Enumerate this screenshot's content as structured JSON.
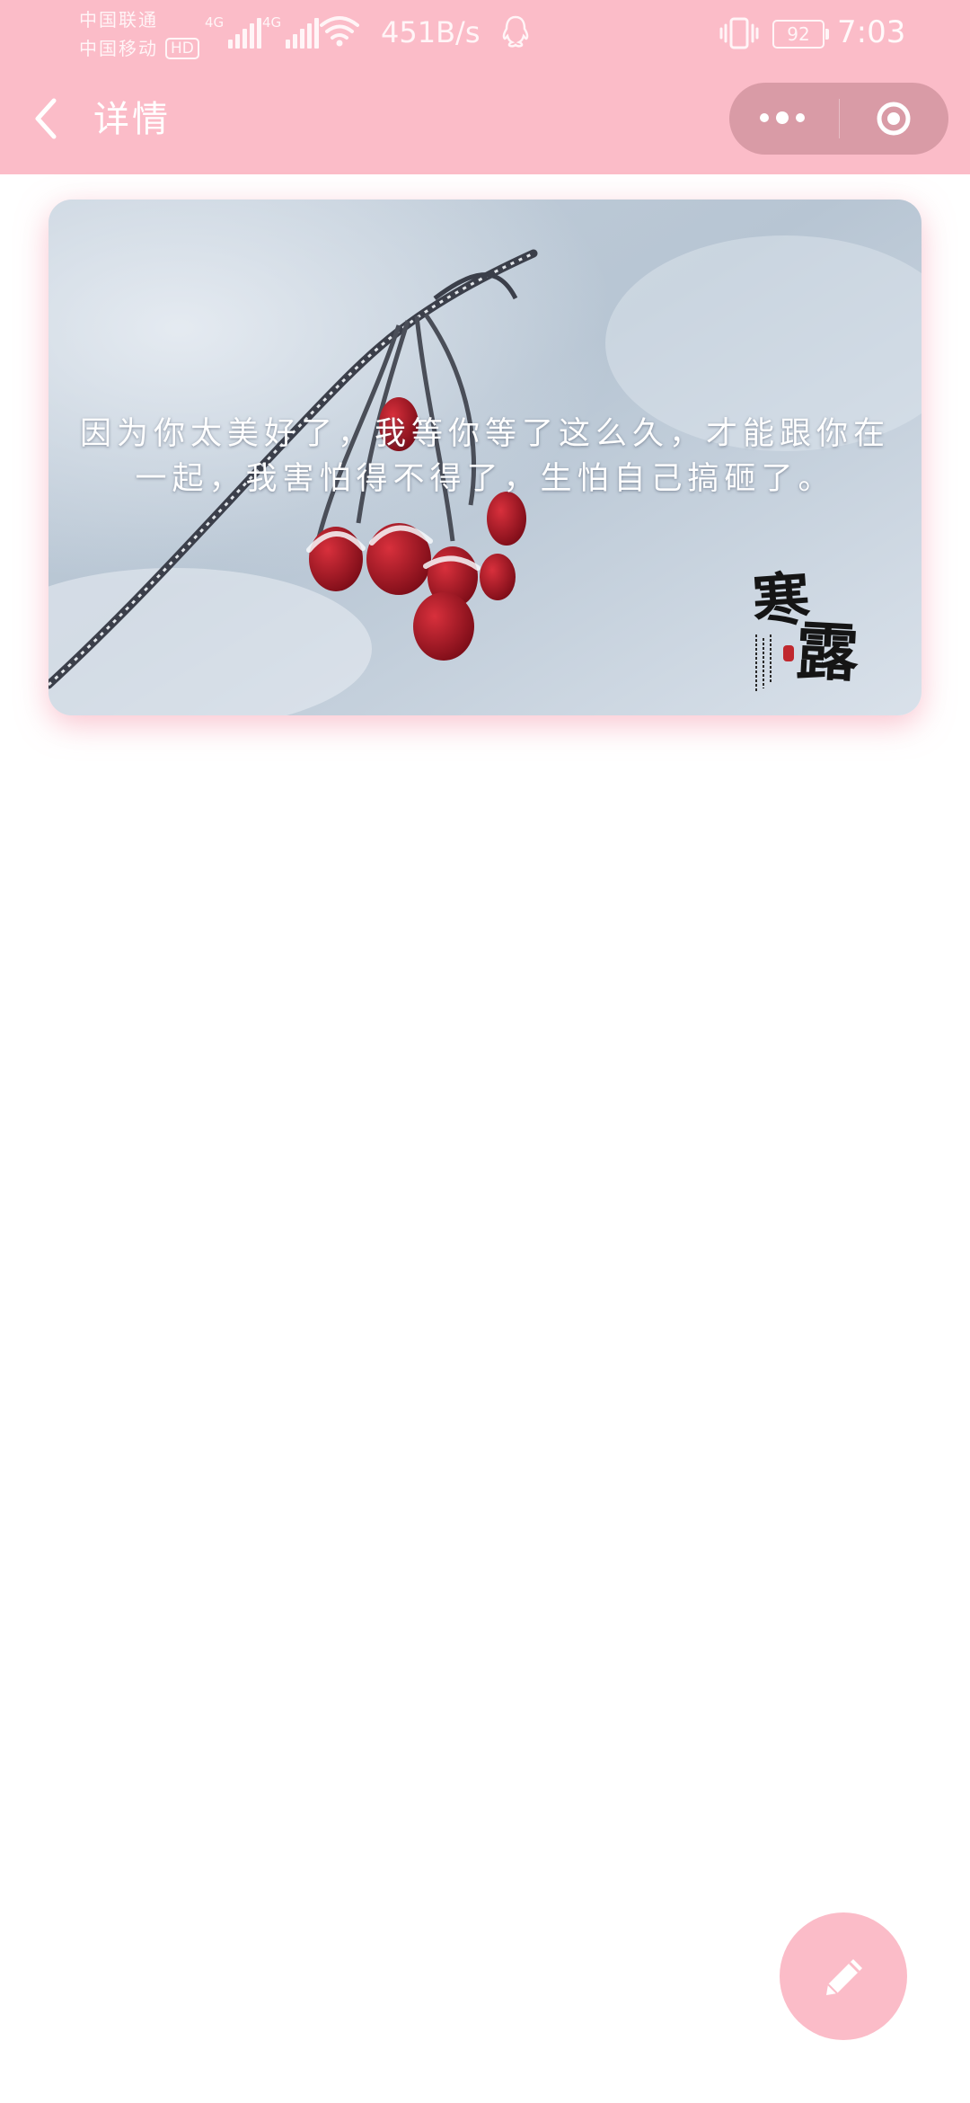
{
  "status_bar": {
    "carrier_1": "中国联通",
    "carrier_2": "中国移动",
    "hd_badge": "HD",
    "signal_1_gen": "4G",
    "signal_2_gen": "4G",
    "net_speed": "451B/s",
    "battery_level": "92",
    "time": "7:03",
    "icons": [
      "signal-icon",
      "wifi-icon",
      "qq-icon",
      "vibrate-icon",
      "battery-icon"
    ]
  },
  "nav": {
    "back_icon": "chevron-left-icon",
    "title": "详情",
    "capsule_more_icon": "more-dots-icon",
    "capsule_close_icon": "target-circle-icon"
  },
  "card": {
    "quote": "因为你太美好了，我等你等了这么久，才能跟你在一起，我害怕得不得了，生怕自己搞砸了。",
    "image_subject": "frosted red berries on branch",
    "stamp_text": "寒露"
  },
  "fab": {
    "icon": "pencil-icon"
  },
  "colors": {
    "header_bg": "#fbbcc8",
    "fab_bg": "#fbbcc8",
    "capsule_bg": "#c48a94",
    "text_white": "#ffffff"
  }
}
